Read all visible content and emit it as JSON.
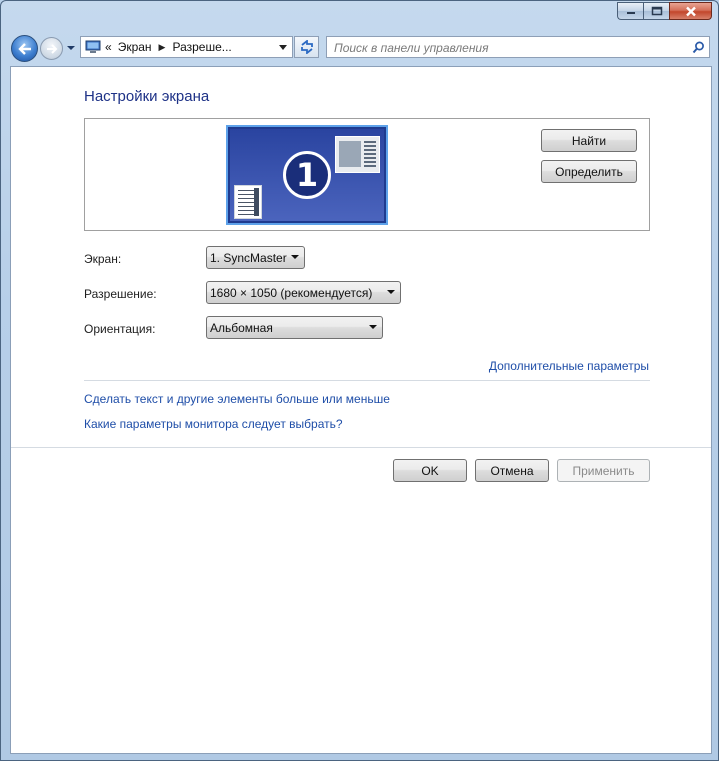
{
  "window": {
    "caption_buttons": [
      "minimize",
      "maximize",
      "close"
    ]
  },
  "nav": {
    "breadcrumb_overflow": "«",
    "breadcrumbs": [
      "Экран",
      "Разреше..."
    ],
    "search_placeholder": "Поиск в панели управления"
  },
  "main": {
    "title": "Настройки экрана",
    "monitor_number": "1",
    "detect_button": "Найти",
    "identify_button": "Определить",
    "display_label": "Экран:",
    "display_value": "1. SyncMaster",
    "resolution_label": "Разрешение:",
    "resolution_value": "1680 × 1050 (рекомендуется)",
    "orientation_label": "Ориентация:",
    "orientation_value": "Альбомная",
    "advanced_link": "Дополнительные параметры",
    "text_size_link": "Сделать текст и другие элементы больше или меньше",
    "monitor_help_link": "Какие параметры монитора следует выбрать?"
  },
  "footer": {
    "ok": "OK",
    "cancel": "Отмена",
    "apply": "Применить"
  }
}
